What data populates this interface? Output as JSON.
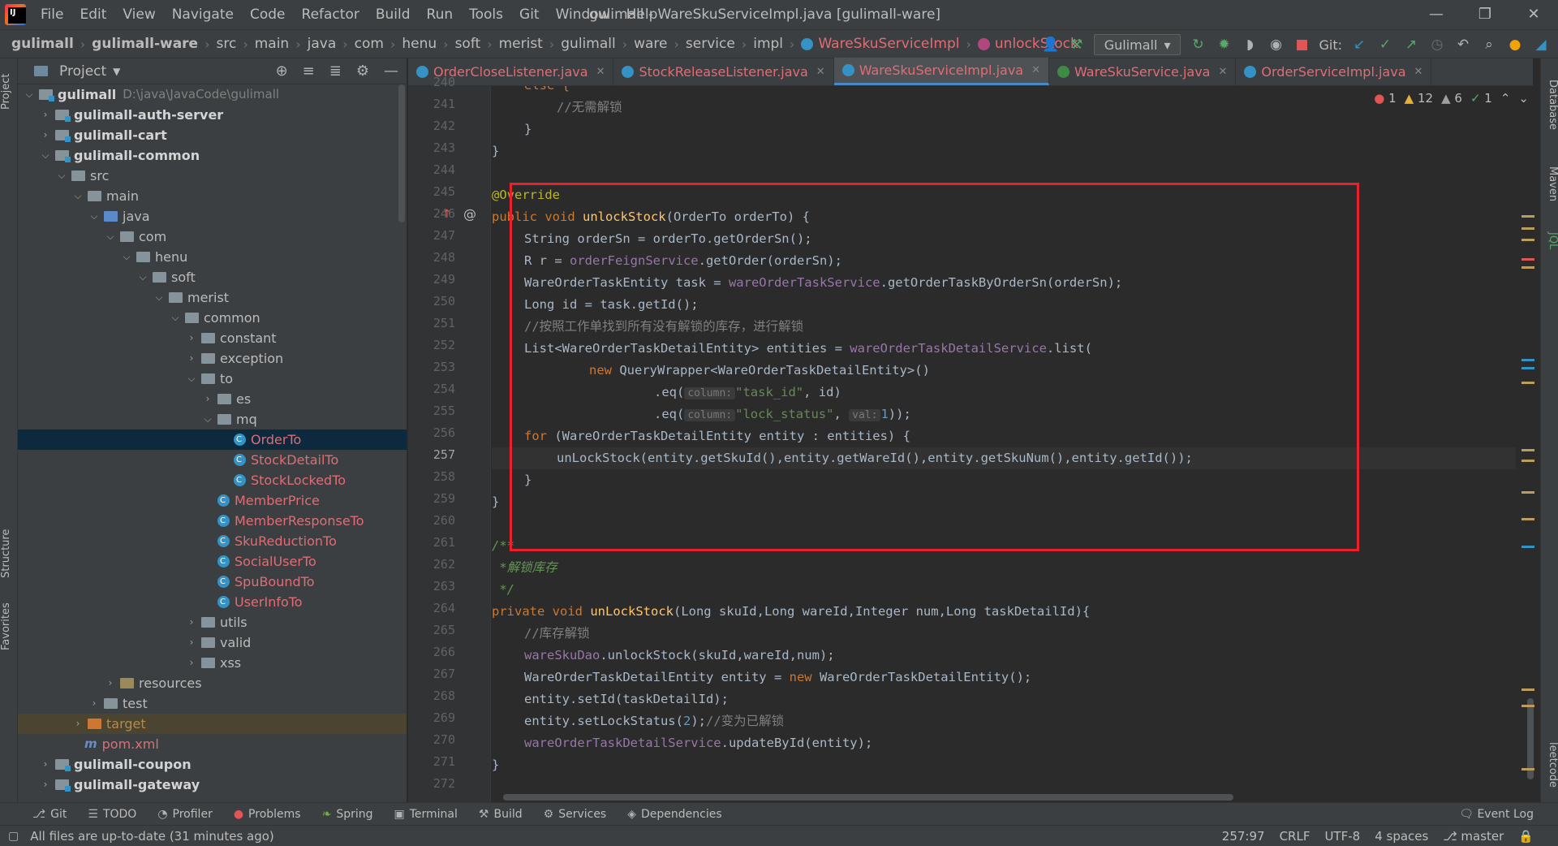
{
  "menu": [
    "File",
    "Edit",
    "View",
    "Navigate",
    "Code",
    "Refactor",
    "Build",
    "Run",
    "Tools",
    "Git",
    "Window",
    "Help"
  ],
  "window_title": "gulimall - WareSkuServiceImpl.java [gulimall-ware]",
  "breadcrumbs": [
    "gulimall",
    "gulimall-ware",
    "src",
    "main",
    "java",
    "com",
    "henu",
    "soft",
    "merist",
    "gulimall",
    "ware",
    "service",
    "impl",
    "WareSkuServiceImpl",
    "unlockStock"
  ],
  "run_config": "Gulimall",
  "git_label": "Git:",
  "project": {
    "title": "Project",
    "root_path": "D:\\java\\JavaCode\\gulimall",
    "tree": [
      "gulimall",
      "gulimall-auth-server",
      "gulimall-cart",
      "gulimall-common",
      "src",
      "main",
      "java",
      "com",
      "henu",
      "soft",
      "merist",
      "common",
      "constant",
      "exception",
      "to",
      "es",
      "mq",
      "OrderTo",
      "StockDetailTo",
      "StockLockedTo",
      "MemberPrice",
      "MemberResponseTo",
      "SkuReductionTo",
      "SocialUserTo",
      "SpuBoundTo",
      "UserInfoTo",
      "utils",
      "valid",
      "xss",
      "resources",
      "test",
      "target",
      "pom.xml",
      "gulimall-coupon",
      "gulimall-gateway"
    ]
  },
  "tabs": [
    "OrderCloseListener.java",
    "StockReleaseListener.java",
    "WareSkuServiceImpl.java",
    "WareSkuService.java",
    "OrderServiceImpl.java"
  ],
  "inspections": {
    "errors": "1",
    "warnings": "12",
    "weak": "6",
    "ok": "1"
  },
  "gutter": [
    "240",
    "241",
    "242",
    "243",
    "244",
    "245",
    "246",
    "247",
    "248",
    "249",
    "250",
    "251",
    "252",
    "253",
    "254",
    "255",
    "256",
    "257",
    "258",
    "259",
    "260",
    "261",
    "262",
    "263",
    "264",
    "265",
    "266",
    "267",
    "268",
    "269",
    "270",
    "271",
    "272"
  ],
  "code": {
    "c240": "else {",
    "c241": "//无需解锁",
    "c242": "}",
    "c243": "}",
    "c245": "@Override",
    "c246_kw": "public void ",
    "c246_fn": "unlockStock",
    "c246_rest": "(OrderTo orderTo) {",
    "c247_a": "String orderSn = orderTo.getOrderSn();",
    "c248_a": "R r = ",
    "c248_f": "orderFeignService",
    "c248_b": ".getOrder(orderSn);",
    "c249_a": "WareOrderTaskEntity task = ",
    "c249_f": "wareOrderTaskService",
    "c249_b": ".getOrderTaskByOrderSn(orderSn);",
    "c250_a": "Long id = task.getId();",
    "c251": "//按照工作单找到所有没有解锁的库存，进行解锁",
    "c252_a": "List<WareOrderTaskDetailEntity> entities = ",
    "c252_f": "wareOrderTaskDetailService",
    "c252_b": ".list(",
    "c253_kw": "new ",
    "c253_b": "QueryWrapper<WareOrderTaskDetailEntity>()",
    "c254_a": ".eq(",
    "c254_h": "column:",
    "c254_s": "\"task_id\"",
    "c254_b": ", id)",
    "c255_a": ".eq(",
    "c255_h": "column:",
    "c255_s": "\"lock_status\"",
    "c255_m": ", ",
    "c255_h2": "val:",
    "c255_n": "1",
    "c255_b": "));",
    "c256_kw": "for ",
    "c256_b": "(WareOrderTaskDetailEntity entity : entities) {",
    "c257": "unLockStock(entity.getSkuId(),entity.getWareId(),entity.getSkuNum(),entity.getId());",
    "c258": "}",
    "c259": "}",
    "c261": "/**",
    "c262": " *解锁库存",
    "c263": " */",
    "c264_kw": "private void ",
    "c264_fn": "unLockStock",
    "c264_b": "(Long skuId,Long wareId,Integer num,Long taskDetailId){",
    "c265": "//库存解锁",
    "c266_f": "wareSkuDao",
    "c266_b": ".unlockStock(skuId,wareId,num);",
    "c267_a": "WareOrderTaskDetailEntity entity = ",
    "c267_kw": "new ",
    "c267_b": "WareOrderTaskDetailEntity();",
    "c268": "entity.setId(taskDetailId);",
    "c269_a": "entity.setLockStatus(",
    "c269_n": "2",
    "c269_b": ");",
    "c269_c": "//变为已解锁",
    "c270_f": "wareOrderTaskDetailService",
    "c270_b": ".updateById(entity);",
    "c271": "}"
  },
  "left_strip": [
    "Project",
    "Structure",
    "Favorites"
  ],
  "right_strip": [
    "Database",
    "Maven",
    "JQL",
    "leetcode"
  ],
  "bottom_tools": [
    "Git",
    "TODO",
    "Profiler",
    "Problems",
    "Spring",
    "Terminal",
    "Build",
    "Services",
    "Dependencies"
  ],
  "event_log": "Event Log",
  "status": {
    "message": "All files are up-to-date (31 minutes ago)",
    "position": "257:97",
    "line_sep": "CRLF",
    "encoding": "UTF-8",
    "indent": "4 spaces",
    "branch": "master"
  },
  "colors": {
    "accent": "#4a88c7",
    "highlight_box": "#e8212b",
    "keyword": "#cc7832",
    "method": "#ffc66d",
    "field": "#9876aa",
    "string": "#6a8759"
  }
}
